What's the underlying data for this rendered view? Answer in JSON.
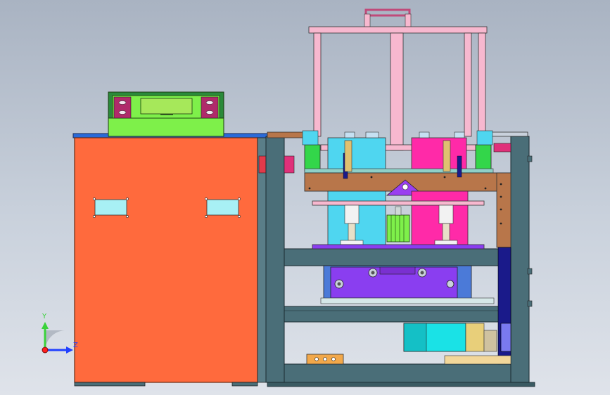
{
  "view": {
    "background_top": "#a9b3c2",
    "background_bottom": "#dfe3ea"
  },
  "triad": {
    "y_axis_label": "Y",
    "z_axis_label": "Z",
    "y_color": "#3ad23a",
    "z_color": "#2040ff",
    "origin_color": "#ff2020"
  },
  "colors": {
    "cabinet": "#ff6a3d",
    "panel_frame": "#3a6a6a",
    "frame_steel": "#4a6e78",
    "pink_frame": "#f7b8cf",
    "cyan": "#4fd6f0",
    "magenta": "#ff2aa8",
    "purple": "#8a3ef0",
    "brown": "#b8764a",
    "lime": "#7ef04a",
    "green": "#33d64a",
    "motor": "#1ae2e6",
    "dark_blue": "#1a1a8a"
  },
  "parts": [
    "control-cabinet",
    "display-panel",
    "frame",
    "pink-lifting-frame",
    "guide-plate",
    "punch-module",
    "motor"
  ]
}
